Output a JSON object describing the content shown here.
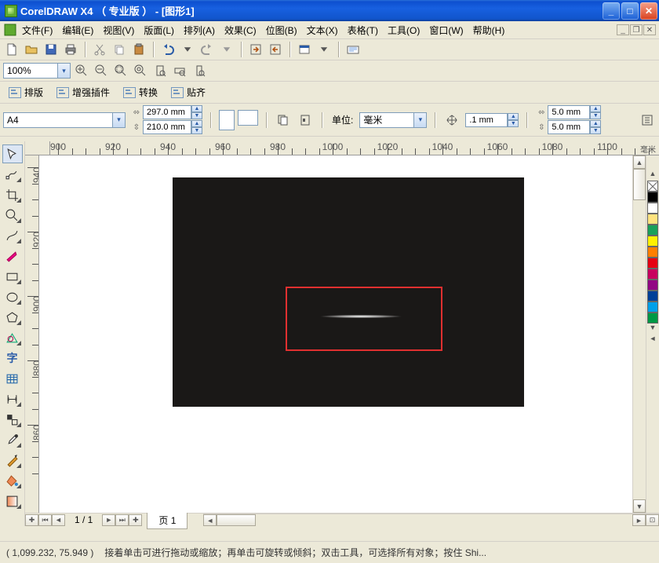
{
  "title": "CorelDRAW X4 （ 专业版 ） - [图形1]",
  "menu": [
    "文件(F)",
    "编辑(E)",
    "视图(V)",
    "版面(L)",
    "排列(A)",
    "效果(C)",
    "位图(B)",
    "文本(X)",
    "表格(T)",
    "工具(O)",
    "窗口(W)",
    "帮助(H)"
  ],
  "zoom": "100%",
  "plugins": [
    "排版",
    "增强插件",
    "转换",
    "贴齐"
  ],
  "paper": "A4",
  "dim_w": "297.0 mm",
  "dim_h": "210.0 mm",
  "unit_label": "单位:",
  "unit": "毫米",
  "nudge": ".1 mm",
  "dup_x": "5.0 mm",
  "dup_y": "5.0 mm",
  "ruler_unit": "毫米",
  "ruler_x": [
    "900",
    "920",
    "940",
    "960",
    "980",
    "1000",
    "1020",
    "1040",
    "1060",
    "1080",
    "1100"
  ],
  "ruler_y": [
    "940",
    "920",
    "900",
    "880",
    "860"
  ],
  "page_idx": "1 / 1",
  "page_tab": "页 1",
  "status_coords": "( 1,099.232, 75.949 )",
  "status_hint": "接着单击可进行拖动或缩放；再单击可旋转或倾斜；双击工具，可选择所有对象；按住 Shi...",
  "palette": [
    "#000",
    "#fff",
    "#ffe37f",
    "#1aa05a",
    "#fff100",
    "#ff7f00",
    "#e60012",
    "#c8005e",
    "#920783",
    "#004098",
    "#00a0e9",
    "#009944"
  ]
}
